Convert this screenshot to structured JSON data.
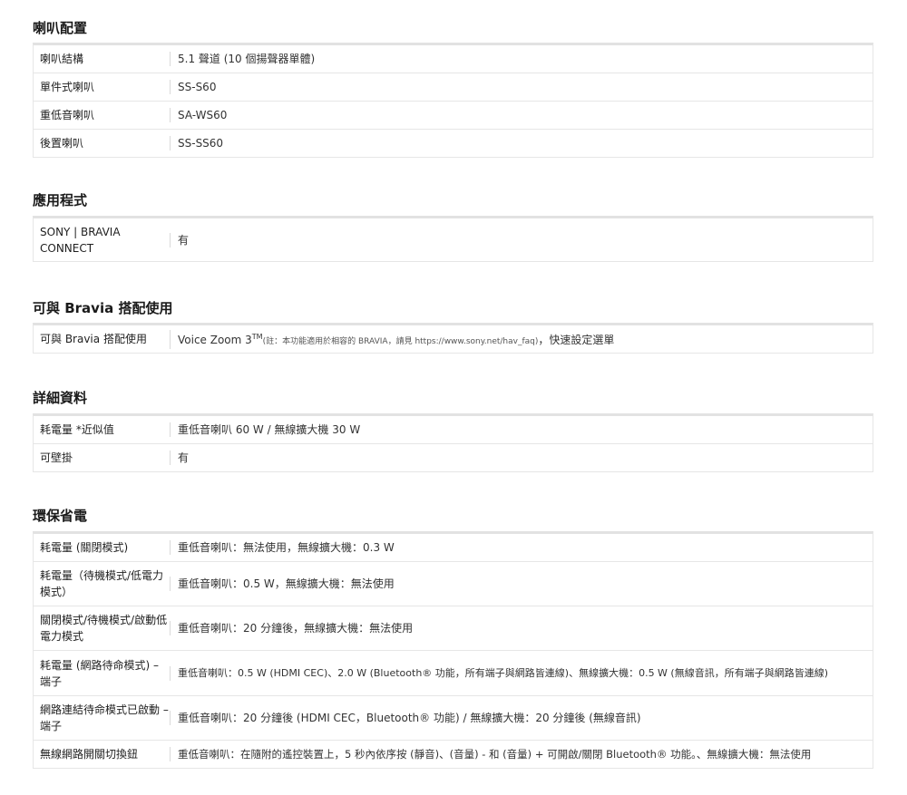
{
  "sections": [
    {
      "title": "喇叭配置",
      "rows": [
        {
          "label": "喇叭結構",
          "value": "5.1 聲道 (10 個揚聲器單體)"
        },
        {
          "label": "單件式喇叭",
          "value": "SS-S60"
        },
        {
          "label": "重低音喇叭",
          "value": "SA-WS60"
        },
        {
          "label": "後置喇叭",
          "value": "SS-SS60"
        }
      ]
    },
    {
      "title": "應用程式",
      "rows": [
        {
          "label": "SONY | BRAVIA CONNECT",
          "value": "有"
        }
      ]
    },
    {
      "title": "可與 Bravia 搭配使用",
      "rows": [
        {
          "label": "可與 Bravia 搭配使用",
          "value_main": "Voice Zoom 3",
          "value_sup": "TM",
          "value_note": "(註：本功能適用於相容的 BRAVIA，請見 https://www.sony.net/hav_faq)",
          "value_tail": "，快速設定選單"
        }
      ]
    },
    {
      "title": "詳細資料",
      "rows": [
        {
          "label": "耗電量 *近似值",
          "value": "重低音喇叭 60 W / 無線擴大機 30 W"
        },
        {
          "label": "可壁掛",
          "value": "有"
        }
      ]
    },
    {
      "title": "環保省電",
      "rows": [
        {
          "label": "耗電量 (關閉模式)",
          "value": "重低音喇叭：無法使用，無線擴大機：0.3 W"
        },
        {
          "label": "耗電量（待機模式/低電力模式）",
          "value": "重低音喇叭：0.5 W，無線擴大機：無法使用"
        },
        {
          "label": "關閉模式/待機模式/啟動低電力模式",
          "value": "重低音喇叭：20 分鐘後，無線擴大機：無法使用"
        },
        {
          "label": "耗電量 (網路待命模式) – 端子",
          "value": "重低音喇叭：0.5 W (HDMI CEC)、2.0 W (Bluetooth® 功能，所有端子與網路皆連線)、無線擴大機：0.5 W (無線音訊，所有端子與網路皆連線)"
        },
        {
          "label": "網路連結待命模式已啟動 – 端子",
          "value": "重低音喇叭：20 分鐘後 (HDMI CEC，Bluetooth® 功能) / 無線擴大機：20 分鐘後 (無線音訊)"
        },
        {
          "label": "無線網路開關切換鈕",
          "value": "重低音喇叭：在隨附的遙控裝置上，5 秒內依序按 (靜音)、(音量) - 和 (音量) + 可開啟/關閉 Bluetooth® 功能。、無線擴大機：無法使用"
        }
      ]
    }
  ]
}
